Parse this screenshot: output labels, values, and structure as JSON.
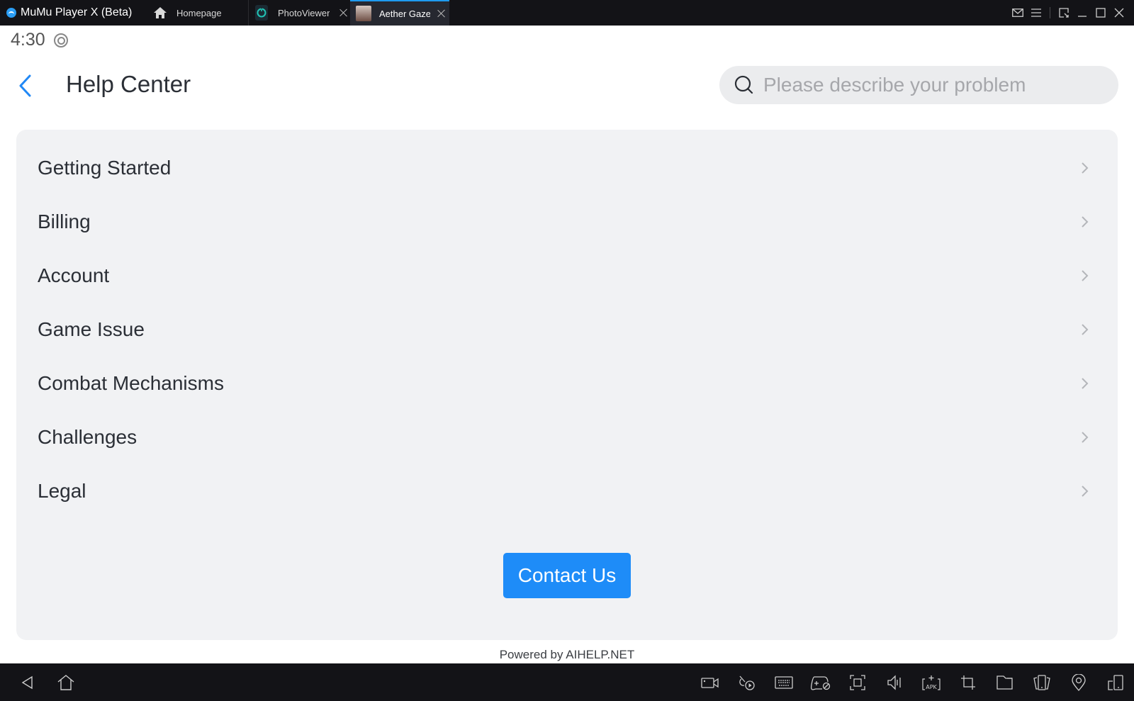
{
  "titlebar": {
    "app_title": "MuMu Player X  (Beta)",
    "tabs": [
      {
        "label": "Homepage",
        "icon": "home-icon",
        "active": false,
        "closable": false
      },
      {
        "label": "PhotoViewer",
        "icon": "photoviewer-app-icon",
        "active": false,
        "closable": true
      },
      {
        "label": "Aether Gazer",
        "icon": "aether-gazer-app-icon",
        "active": true,
        "closable": true
      }
    ],
    "window_controls": [
      "mail-icon",
      "menu-icon",
      "resize-icon",
      "minimize-icon",
      "maximize-icon",
      "close-icon"
    ],
    "accent_color": "#1e9bf0"
  },
  "status": {
    "time": "4:30",
    "icon": "sync-status-icon"
  },
  "header": {
    "title": "Help Center",
    "back_icon": "chevron-left-icon",
    "search": {
      "placeholder": "Please describe your problem",
      "value": ""
    }
  },
  "categories": [
    {
      "label": "Getting Started"
    },
    {
      "label": "Billing"
    },
    {
      "label": "Account"
    },
    {
      "label": "Game Issue"
    },
    {
      "label": "Combat Mechanisms"
    },
    {
      "label": "Challenges"
    },
    {
      "label": "Legal"
    }
  ],
  "contact_button": {
    "label": "Contact Us",
    "color": "#1e8cf8"
  },
  "footer": {
    "powered_by": "Powered by AIHELP.NET"
  },
  "navbar": {
    "left": [
      "back-icon",
      "home-icon"
    ],
    "right": [
      "screen-record-icon",
      "macro-play-icon",
      "keyboard-mapping-icon",
      "gamepad-disabled-icon",
      "fullscreen-icon",
      "volume-icon",
      "install-apk-icon",
      "crop-icon",
      "folder-icon",
      "multi-instance-icon",
      "location-icon",
      "rotate-screen-icon"
    ]
  }
}
